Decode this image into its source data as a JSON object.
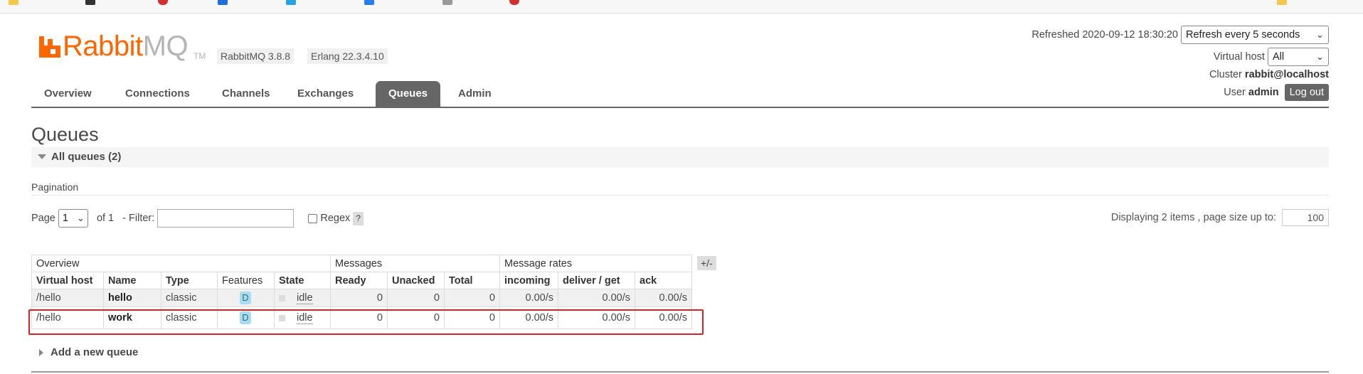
{
  "colors": {
    "brand": "#ff6600",
    "tab_active": "#666666",
    "highlight": "#e02020",
    "feature_badge": "#aadcef"
  },
  "header": {
    "logo_rabbit": "Rabbit",
    "logo_mq": "MQ",
    "logo_tm": "TM",
    "rabbitmq_version": "RabbitMQ 3.8.8",
    "erlang_version": "Erlang 22.3.4.10",
    "refreshed_label": "Refreshed 2020-09-12 18:30:20",
    "refresh_select": "Refresh every 5 seconds",
    "vhost_label": "Virtual host",
    "vhost_select": "All",
    "cluster_label": "Cluster",
    "cluster_value": "rabbit@localhost",
    "user_label": "User",
    "user_value": "admin",
    "logout_label": "Log out"
  },
  "tabs": [
    {
      "label": "Overview"
    },
    {
      "label": "Connections"
    },
    {
      "label": "Channels"
    },
    {
      "label": "Exchanges"
    },
    {
      "label": "Queues",
      "active": true
    },
    {
      "label": "Admin"
    }
  ],
  "page": {
    "title": "Queues",
    "section_label": "All queues (2)",
    "pagination_label": "Pagination",
    "page_label": "Page",
    "page_select": "1",
    "of_label": "of 1",
    "filter_label": "- Filter:",
    "regex_label": "Regex",
    "help_label": "?",
    "displaying_label": "Displaying 2 items , page size up to:",
    "page_size": "100",
    "plusminus": "+/-",
    "add_queue_label": "Add a new queue"
  },
  "table": {
    "groups": [
      "Overview",
      "Messages",
      "Message rates"
    ],
    "headers": [
      "Virtual host",
      "Name",
      "Type",
      "Features",
      "State",
      "Ready",
      "Unacked",
      "Total",
      "incoming",
      "deliver / get",
      "ack"
    ],
    "rows": [
      {
        "vhost": "/hello",
        "name": "hello",
        "type": "classic",
        "feature": "D",
        "state": "idle",
        "ready": "0",
        "unacked": "0",
        "total": "0",
        "incoming": "0.00/s",
        "deliver": "0.00/s",
        "ack": "0.00/s"
      },
      {
        "vhost": "/hello",
        "name": "work",
        "type": "classic",
        "feature": "D",
        "state": "idle",
        "ready": "0",
        "unacked": "0",
        "total": "0",
        "incoming": "0.00/s",
        "deliver": "0.00/s",
        "ack": "0.00/s"
      }
    ]
  }
}
